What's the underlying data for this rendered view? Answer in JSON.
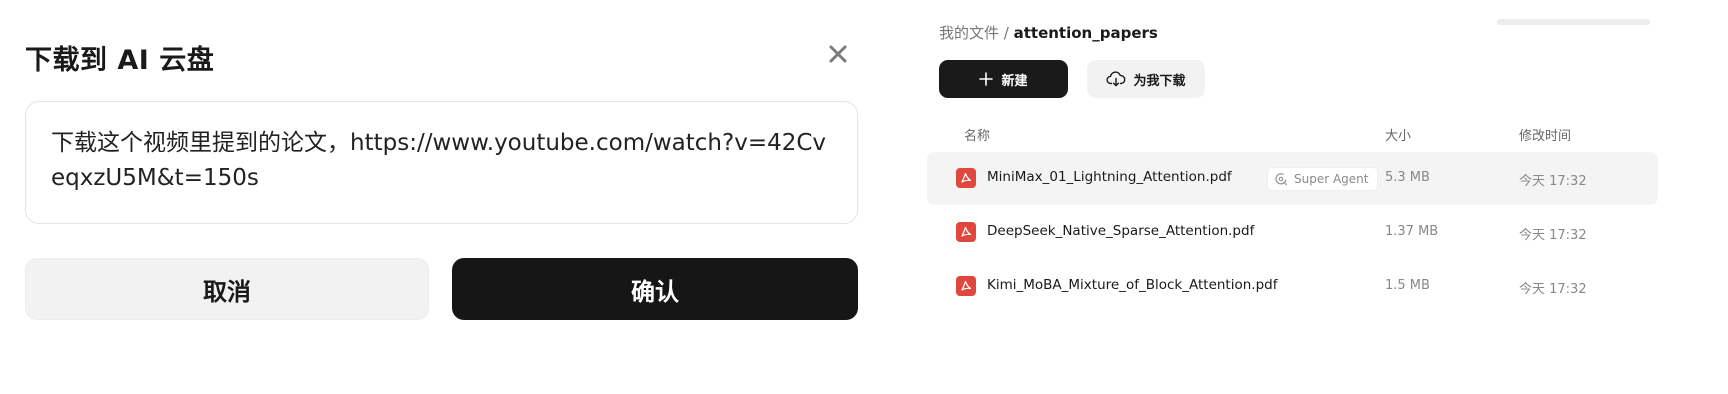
{
  "dialog": {
    "title": "下载到 AI 云盘",
    "prompt": "下载这个视频里提到的论文，https://www.youtube.com/watch?v=42CveqxzU5M&t=150s",
    "cancel_label": "取消",
    "confirm_label": "确认"
  },
  "panel": {
    "breadcrumb": {
      "root": "我的文件",
      "separator": " / ",
      "current": "attention_papers"
    },
    "new_label": "新建",
    "download_label": "为我下载",
    "columns": {
      "name": "名称",
      "size": "大小",
      "modified": "修改时间"
    },
    "files": [
      {
        "name": "MiniMax_01_Lightning_Attention.pdf",
        "tag": "Super Agent",
        "size": "5.3 MB",
        "time": "今天 17:32"
      },
      {
        "name": "DeepSeek_Native_Sparse_Attention.pdf",
        "size": "1.37 MB",
        "time": "今天 17:32"
      },
      {
        "name": "Kimi_MoBA_Mixture_of_Block_Attention.pdf",
        "size": "1.5 MB",
        "time": "今天 17:32"
      }
    ]
  },
  "icons": {
    "close": "close-icon",
    "new": "plus-icon",
    "download": "cloud-download-icon",
    "file": "pdf-icon",
    "tag": "agent-icon"
  },
  "colors": {
    "primary_dark": "#161616",
    "pdf_red": "#e0473e",
    "row_highlight": "#f4f4f4"
  }
}
